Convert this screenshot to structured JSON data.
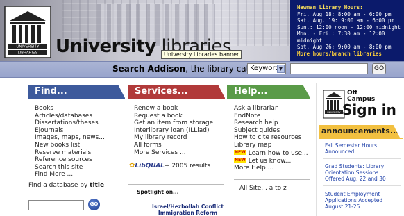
{
  "header": {
    "title_bold": "University",
    "title_rest": " libraries",
    "tooltip": "University Libraries banner",
    "logo_top": "UNIVERSITY",
    "logo_bottom": "LIBRARIES"
  },
  "hours": {
    "title": "Newman Library Hours:",
    "lines": [
      "Fri. Aug 18: 8:00 am - 6:00 pm",
      "Sat. Aug. 19: 9:00 am - 6:00 pm",
      "Sun.: 12:00 noon - 12:00 midnight",
      "Mon. - Fri.: 7:30 am - 12:00 midnight",
      "Sat. Aug 26: 9:00 am - 8:00 pm"
    ],
    "more_link": "More hours/branch libraries"
  },
  "search": {
    "label_bold": "Search Addison",
    "label_rest": ", the library catalog:",
    "select_value": "Keyword",
    "input_value": "",
    "go_label": "GO"
  },
  "tabs": {
    "find": "Find...",
    "services": "Services...",
    "help": "Help..."
  },
  "find": {
    "items": [
      "Books",
      "Articles/databases",
      "Dissertations/theses",
      "Ejournals",
      "Images, maps, news...",
      "New books list",
      "Reserve materials",
      "Reference sources",
      "Search this site",
      "Find More ..."
    ],
    "db_prefix": "Find a database by ",
    "db_bold": "title",
    "db_go": "GO"
  },
  "services": {
    "items": [
      "Renew a book",
      "Request a book",
      "Get an item from storage",
      "Interlibrary loan (ILLiad)",
      "My library record",
      "All forms",
      "More Services ..."
    ],
    "libqual_name": "LibQUAL",
    "libqual_rest": "+ 2005 results",
    "spotlight": "Spotlight on...",
    "spot_link1": "Israel/Hezbollah Conflict",
    "spot_link2": "Immigration Reform"
  },
  "help": {
    "items": [
      "Ask a librarian",
      "EndNote",
      "Research help",
      "Subject guides",
      "How to cite resources",
      "Library map"
    ],
    "new_label": "NEW",
    "new_items": [
      "Learn how to use...",
      "Let us know..."
    ],
    "more": "More Help ...",
    "allsite": "All Site... a to z"
  },
  "sidebar": {
    "off": "Off",
    "campus": "Campus",
    "signin": "Sign in",
    "logo_top": "UNIVERSITY",
    "announcements": "announcements...",
    "news": [
      [
        "Fall Semester Hours",
        "Announced"
      ],
      [
        "Grad Students: Library",
        "Orientation Sessions",
        "Offered Aug. 22 and 30"
      ],
      [
        "Student Employment",
        "Applications Accepted",
        "August 21-25"
      ]
    ]
  }
}
